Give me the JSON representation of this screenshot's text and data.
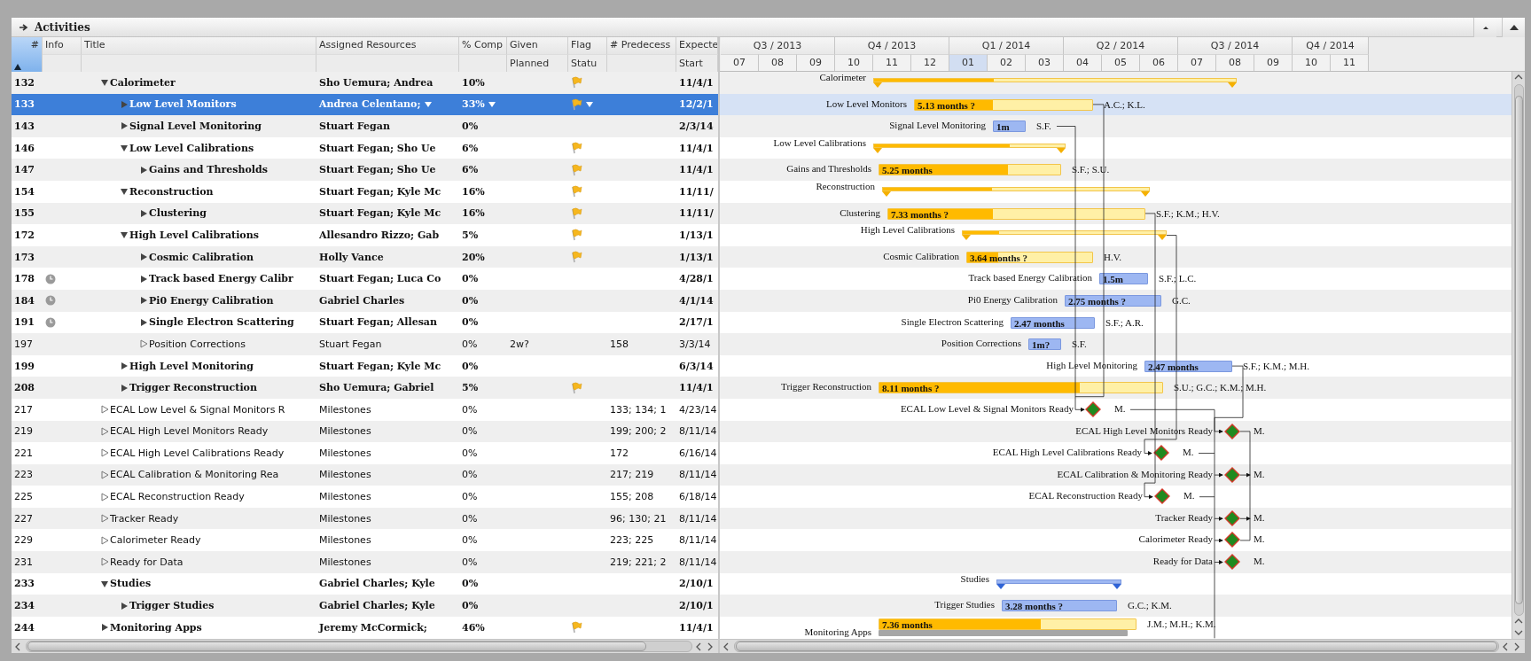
{
  "panel": {
    "title": "Activities"
  },
  "columns": [
    {
      "label": "#",
      "sorted": true
    },
    {
      "label": "Info",
      "sorted": false
    },
    {
      "label": "Title",
      "sorted": false
    },
    {
      "label": "Assigned Resources",
      "sorted": false
    },
    {
      "label": "% Comp",
      "sorted": false
    },
    {
      "label": "Given",
      "sublabel": "Planned",
      "sorted": false
    },
    {
      "label": "Flag",
      "sublabel": "Statu",
      "sorted": false
    },
    {
      "label": "# Predecess",
      "sorted": false
    },
    {
      "label": "Expecte",
      "sublabel": "Start",
      "sorted": false
    }
  ],
  "timeline": [
    {
      "label": "Q3 / 2013",
      "months": [
        {
          "label": "07",
          "current": false
        },
        {
          "label": "08",
          "current": false
        },
        {
          "label": "09",
          "current": false
        }
      ]
    },
    {
      "label": "Q4 / 2013",
      "months": [
        {
          "label": "10",
          "current": false
        },
        {
          "label": "11",
          "current": false
        },
        {
          "label": "12",
          "current": false
        }
      ]
    },
    {
      "label": "Q1 / 2014",
      "months": [
        {
          "label": "01",
          "current": true
        },
        {
          "label": "02",
          "current": false
        },
        {
          "label": "03",
          "current": false
        }
      ]
    },
    {
      "label": "Q2 / 2014",
      "months": [
        {
          "label": "04",
          "current": false
        },
        {
          "label": "05",
          "current": false
        },
        {
          "label": "06",
          "current": false
        }
      ]
    },
    {
      "label": "Q3 / 2014",
      "months": [
        {
          "label": "07",
          "current": false
        },
        {
          "label": "08",
          "current": false
        },
        {
          "label": "09",
          "current": false
        }
      ]
    },
    {
      "label": "Q4 / 2014",
      "months": [
        {
          "label": "10",
          "current": false
        },
        {
          "label": "11",
          "current": false
        }
      ]
    }
  ],
  "rows": [
    {
      "id": "132",
      "clock": false,
      "title": "Calorimeter",
      "kind": "group",
      "expanded": true,
      "resources": "Sho Uemura; Andrea",
      "complete": "10%",
      "flagged": true,
      "start": "11/4/1",
      "selected": false,
      "gantt": {
        "kind": "summary",
        "started": true,
        "label": "Calorimeter",
        "level": 0.33
      },
      "children": [
        {
          "id": "133",
          "clock": false,
          "title": "Low Level Monitors",
          "kind": "group",
          "expanded": false,
          "resources": "Andrea Celentano;",
          "complete": "33%",
          "flagged": true,
          "start": "12/2/1",
          "selected": true,
          "gantt": {
            "kind": "task",
            "started": true,
            "label": "Low Level Monitors",
            "duration": "5.13 months ?",
            "resources": "A.C.; K.L.",
            "level": 0.44
          }
        },
        {
          "id": "143",
          "clock": false,
          "title": "Signal Level Monitoring",
          "kind": "group",
          "expanded": false,
          "resources": "Stuart Fegan",
          "complete": "0%",
          "flagged": false,
          "start": "2/3/14",
          "selected": false,
          "gantt": {
            "kind": "task",
            "started": false,
            "label": "Signal Level Monitoring",
            "duration": "1m",
            "resources": "S.F."
          }
        },
        {
          "id": "146",
          "clock": false,
          "title": "Low Level Calibrations",
          "kind": "group",
          "expanded": true,
          "resources": "Stuart Fegan; Sho Ue",
          "complete": "6%",
          "flagged": true,
          "start": "11/4/1",
          "selected": false,
          "gantt": {
            "kind": "summary",
            "started": true,
            "label": "Low Level Calibrations",
            "level": 0.71
          },
          "children": [
            {
              "id": "147",
              "clock": false,
              "title": "Gains and Thresholds",
              "kind": "group",
              "expanded": false,
              "resources": "Stuart Fegan; Sho Ue",
              "complete": "6%",
              "flagged": true,
              "start": "11/4/1",
              "selected": false,
              "gantt": {
                "kind": "task",
                "started": true,
                "label": "Gains and Thresholds",
                "duration": "5.25 months",
                "resources": "S.F.; S.U.",
                "level": 0.71
              }
            }
          ]
        },
        {
          "id": "154",
          "clock": false,
          "title": "Reconstruction",
          "kind": "group",
          "expanded": true,
          "resources": "Stuart Fegan; Kyle Mc",
          "complete": "16%",
          "flagged": true,
          "start": "11/11/",
          "selected": false,
          "gantt": {
            "kind": "summary",
            "started": true,
            "label": "Reconstruction",
            "level": 0.41
          },
          "children": [
            {
              "id": "155",
              "clock": false,
              "title": "Clustering",
              "kind": "group",
              "expanded": false,
              "resources": "Stuart Fegan; Kyle Mc",
              "complete": "16%",
              "flagged": true,
              "start": "11/11/",
              "selected": false,
              "gantt": {
                "kind": "task",
                "started": true,
                "label": "Clustering",
                "duration": "7.33 months ?",
                "resources": "S.F.; K.M.; H.V.",
                "level": 0.41
              }
            }
          ]
        },
        {
          "id": "172",
          "clock": false,
          "title": "High Level Calibrations",
          "kind": "group",
          "expanded": true,
          "resources": "Allesandro Rizzo; Gab",
          "complete": "5%",
          "flagged": true,
          "start": "1/13/1",
          "selected": false,
          "gantt": {
            "kind": "summary",
            "started": true,
            "label": "High Level Calibrations",
            "level": 0.18
          },
          "children": [
            {
              "id": "173",
              "clock": false,
              "title": "Cosmic Calibration",
              "kind": "group",
              "expanded": false,
              "resources": "Holly Vance",
              "complete": "20%",
              "flagged": true,
              "start": "1/13/1",
              "selected": false,
              "gantt": {
                "kind": "task",
                "started": true,
                "label": "Cosmic Calibration",
                "duration": "3.64 months ?",
                "resources": "H.V.",
                "level": 0.25
              }
            },
            {
              "id": "178",
              "clock": true,
              "title": "Track based Energy Calibr",
              "kind": "group",
              "expanded": false,
              "resources": "Stuart Fegan; Luca Co",
              "complete": "0%",
              "flagged": false,
              "start": "4/28/1",
              "selected": false,
              "gantt": {
                "kind": "task",
                "started": false,
                "label": "Track based Energy Calibration",
                "duration": "1.5m",
                "resources": "S.F.; L.C."
              }
            },
            {
              "id": "184",
              "clock": true,
              "title": "Pi0 Energy Calibration",
              "kind": "group",
              "expanded": false,
              "resources": "Gabriel Charles",
              "complete": "0%",
              "flagged": false,
              "start": "4/1/14",
              "selected": false,
              "gantt": {
                "kind": "task",
                "started": false,
                "label": "Pi0 Energy Calibration",
                "duration": "2.75 months ?",
                "resources": "G.C."
              }
            },
            {
              "id": "191",
              "clock": true,
              "title": "Single Electron Scattering",
              "kind": "group",
              "expanded": false,
              "resources": "Stuart Fegan; Allesan",
              "complete": "0%",
              "flagged": false,
              "start": "2/17/1",
              "selected": false,
              "gantt": {
                "kind": "task",
                "started": false,
                "label": "Single Electron Scattering",
                "duration": "2.47 months",
                "resources": "S.F.; A.R."
              }
            },
            {
              "id": "197",
              "clock": false,
              "title": "Position Corrections",
              "kind": "leaf",
              "resources": "Stuart Fegan",
              "complete": "0%",
              "given": "2w?",
              "flagged": false,
              "predecessors": "158",
              "start": "3/3/14",
              "selected": false,
              "gantt": {
                "kind": "task",
                "started": false,
                "label": "Position Corrections",
                "duration": "1m?",
                "resources": "S.F."
              }
            }
          ]
        },
        {
          "id": "199",
          "clock": false,
          "title": "High Level Monitoring",
          "kind": "group",
          "expanded": false,
          "resources": "Stuart Fegan; Kyle Mc",
          "complete": "0%",
          "flagged": false,
          "start": "6/3/14",
          "selected": false,
          "gantt": {
            "kind": "task",
            "started": false,
            "label": "High Level Monitoring",
            "duration": "2.47 months",
            "resources": "S.F.; K.M.; M.H."
          }
        },
        {
          "id": "208",
          "clock": false,
          "title": "Trigger Reconstruction",
          "kind": "group",
          "expanded": false,
          "resources": "Sho Uemura; Gabriel",
          "complete": "5%",
          "flagged": true,
          "start": "11/4/1",
          "selected": false,
          "gantt": {
            "kind": "task",
            "started": true,
            "label": "Trigger Reconstruction",
            "duration": "8.11 months ?",
            "resources": "S.U.; G.C.; K.M.; M.H.",
            "level": 0.71
          }
        }
      ]
    },
    {
      "id": "217",
      "clock": false,
      "title": "ECAL Low Level & Signal Monitors R",
      "kind": "leaf",
      "resources": "Milestones",
      "complete": "0%",
      "flagged": false,
      "predecessors": "133; 134; 1",
      "start": "4/23/14",
      "selected": false,
      "gantt": {
        "kind": "milestone",
        "label": "ECAL Low Level & Signal Monitors Ready",
        "resources": "M."
      }
    },
    {
      "id": "219",
      "clock": false,
      "title": "ECAL High Level Monitors Ready",
      "kind": "leaf",
      "resources": "Milestones",
      "complete": "0%",
      "flagged": false,
      "predecessors": "199; 200; 2",
      "start": "8/11/14",
      "selected": false,
      "gantt": {
        "kind": "milestone",
        "label": "ECAL High Level Monitors Ready",
        "resources": "M."
      }
    },
    {
      "id": "221",
      "clock": false,
      "title": "ECAL High Level Calibrations Ready",
      "kind": "leaf",
      "resources": "Milestones",
      "complete": "0%",
      "flagged": false,
      "predecessors": "172",
      "start": "6/16/14",
      "selected": false,
      "gantt": {
        "kind": "milestone",
        "label": "ECAL High Level Calibrations Ready",
        "resources": "M."
      }
    },
    {
      "id": "223",
      "clock": false,
      "title": "ECAL Calibration & Monitoring Rea",
      "kind": "leaf",
      "resources": "Milestones",
      "complete": "0%",
      "flagged": false,
      "predecessors": "217; 219",
      "start": "8/11/14",
      "selected": false,
      "gantt": {
        "kind": "milestone",
        "label": "ECAL Calibration & Monitoring Ready",
        "resources": "M."
      }
    },
    {
      "id": "225",
      "clock": false,
      "title": "ECAL Reconstruction Ready",
      "kind": "leaf",
      "resources": "Milestones",
      "complete": "0%",
      "flagged": false,
      "predecessors": "155; 208",
      "start": "6/18/14",
      "selected": false,
      "gantt": {
        "kind": "milestone",
        "label": "ECAL Reconstruction Ready",
        "resources": "M."
      }
    },
    {
      "id": "227",
      "clock": false,
      "title": "Tracker Ready",
      "kind": "leaf",
      "resources": "Milestones",
      "complete": "0%",
      "flagged": false,
      "predecessors": "96; 130; 21",
      "start": "8/11/14",
      "selected": false,
      "gantt": {
        "kind": "milestone",
        "label": "Tracker Ready",
        "resources": "M."
      }
    },
    {
      "id": "229",
      "clock": false,
      "title": "Calorimeter Ready",
      "kind": "leaf",
      "resources": "Milestones",
      "complete": "0%",
      "flagged": false,
      "predecessors": "223; 225",
      "start": "8/11/14",
      "selected": false,
      "gantt": {
        "kind": "milestone",
        "label": "Calorimeter Ready",
        "resources": "M."
      }
    },
    {
      "id": "231",
      "clock": false,
      "title": "Ready for Data",
      "kind": "leaf",
      "resources": "Milestones",
      "complete": "0%",
      "flagged": false,
      "predecessors": "219; 221; 2",
      "start": "8/11/14",
      "selected": false,
      "gantt": {
        "kind": "milestone",
        "label": "Ready for Data",
        "resources": "M."
      }
    },
    {
      "id": "233",
      "clock": false,
      "title": "Studies",
      "kind": "group",
      "expanded": true,
      "resources": "Gabriel Charles; Kyle",
      "complete": "0%",
      "flagged": false,
      "start": "2/10/1",
      "selected": false,
      "gantt": {
        "kind": "summary",
        "started": false,
        "label": "Studies"
      },
      "children": [
        {
          "id": "234",
          "clock": false,
          "title": "Trigger Studies",
          "kind": "group",
          "expanded": false,
          "resources": "Gabriel Charles; Kyle",
          "complete": "0%",
          "flagged": false,
          "start": "2/10/1",
          "selected": false,
          "gantt": {
            "kind": "task",
            "started": false,
            "label": "Trigger Studies",
            "duration": "3.28 months ?",
            "resources": "G.C.; K.M."
          }
        }
      ]
    },
    {
      "id": "244",
      "clock": false,
      "title": "Monitoring Apps",
      "kind": "group",
      "expanded": false,
      "resources": "Jeremy McCormick;",
      "complete": "46%",
      "flagged": true,
      "start": "11/4/1",
      "selected": false,
      "gantt": {
        "kind": "task",
        "started": true,
        "label": "Monitoring Apps",
        "duration": "7.36 months",
        "resources": "J.M.; M.H.; K.M.",
        "level": 0.63,
        "baseline": true
      }
    }
  ]
}
